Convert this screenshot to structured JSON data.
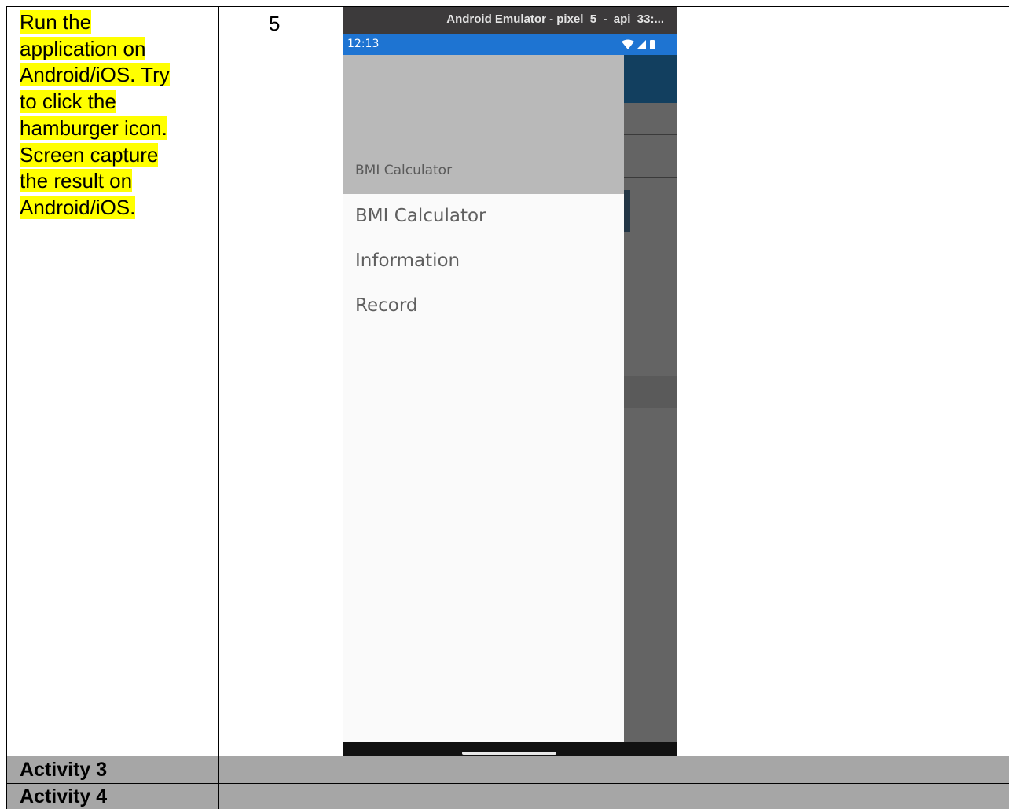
{
  "row1": {
    "instruction_lines": [
      "Run the",
      "application on",
      "Android/iOS. Try",
      "to click the",
      "hamburger icon.",
      "Screen capture",
      "the result on",
      "Android/iOS."
    ],
    "score": "5"
  },
  "emulator": {
    "window_title": "Android Emulator - pixel_5_-_api_33:...",
    "status_time": "12:13",
    "status_icons": [
      "wifi-icon",
      "signal-icon",
      "battery-icon"
    ],
    "drawer_header_title": "BMI Calculator",
    "drawer_items": [
      "BMI Calculator",
      "Information",
      "Record"
    ],
    "colors": {
      "status_bar": "#1e74d2",
      "app_bar": "#123f5f",
      "drawer_header": "#b9b9b9"
    }
  },
  "rows": [
    {
      "label": "Activity 3"
    },
    {
      "label": "Activity 4"
    }
  ],
  "colors": {
    "highlight": "#ffff00",
    "activity_row": "#a6a6a6"
  }
}
